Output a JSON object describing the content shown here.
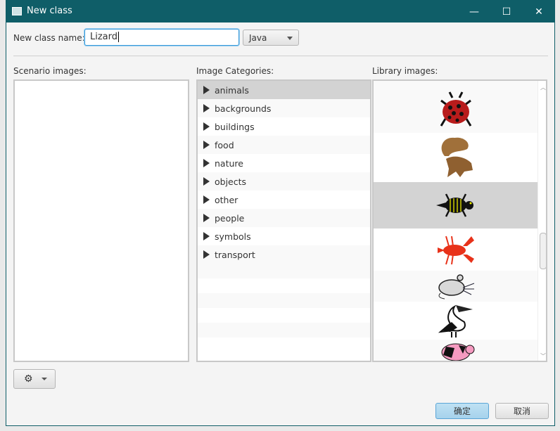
{
  "window": {
    "title": "New class",
    "minimize": "—",
    "maximize": "☐",
    "close": "✕"
  },
  "form": {
    "name_label": "New class name:",
    "name_value": "Lizard",
    "language": "Java"
  },
  "scenario": {
    "label": "Scenario images:"
  },
  "categories": {
    "label": "Image Categories:",
    "items": [
      "animals",
      "backgrounds",
      "buildings",
      "food",
      "nature",
      "objects",
      "other",
      "people",
      "symbols",
      "transport"
    ],
    "selected": "animals"
  },
  "library": {
    "label": "Library images:",
    "items": [
      "ladybug",
      "squirrel",
      "lizard",
      "lobster",
      "mouse",
      "pelican",
      "pig"
    ],
    "selected": "lizard"
  },
  "buttons": {
    "ok": "确定",
    "cancel": "取消",
    "gear": "⚙"
  },
  "colors": {
    "titlebar": "#0f5e68",
    "accent": "#3a9ad9",
    "selected": "#d3d3d3"
  }
}
